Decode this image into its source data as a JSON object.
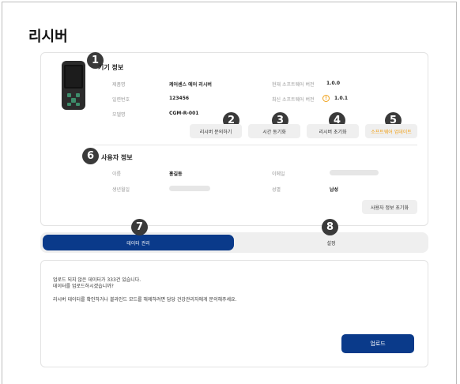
{
  "page": {
    "title": "리시버"
  },
  "device_info": {
    "badge": "1",
    "title": "기기 정보",
    "product_label": "제품명",
    "product_value": "케어센스 에어 리시버",
    "serial_label": "일련번호",
    "serial_value": "123456",
    "model_label": "모델명",
    "model_value": "CGM-R-001",
    "current_sw_label": "현재 소프트웨어 버전",
    "current_sw_value": "1.0.0",
    "latest_sw_label": "최신 소프트웨어 버전",
    "latest_sw_value": "1.0.1"
  },
  "actions": {
    "inquiry": {
      "badge": "2",
      "label": "리시버 문의하기"
    },
    "time_sync": {
      "badge": "3",
      "label": "시간 동기화"
    },
    "reset": {
      "badge": "4",
      "label": "리시버 초기화"
    },
    "sw_update": {
      "badge": "5",
      "label": "소프트웨어 업데이트",
      "color": "#f0a21c"
    }
  },
  "user_info": {
    "badge": "6",
    "title": "사용자 정보",
    "name_label": "이름",
    "name_value": "홍길동",
    "email_label": "이메일",
    "birth_label": "생년월일",
    "gender_label": "성별",
    "gender_value": "남성",
    "reset_button": "사용자 정보 초기화"
  },
  "tabs": [
    {
      "badge": "7",
      "label": "데이터 관리",
      "active": true
    },
    {
      "badge": "8",
      "label": "설정",
      "active": false
    }
  ],
  "data_panel": {
    "line1": "업로드 되지 않은 데이터가 333건 있습니다.",
    "line2": "데이터를 업로드하시겠습니까?",
    "line3": "리시버 데이터를 확인하거나 블라인드 모드를 해제하려면 담당 건강관리자에게 문의해주세요.",
    "upload_button": "업로드"
  },
  "colors": {
    "primary": "#0a3a8a",
    "accent": "#f0a21c",
    "badge": "#3a3a3a"
  },
  "icons": {
    "warning": "warning-circle-icon",
    "device": "receiver-device-icon"
  }
}
